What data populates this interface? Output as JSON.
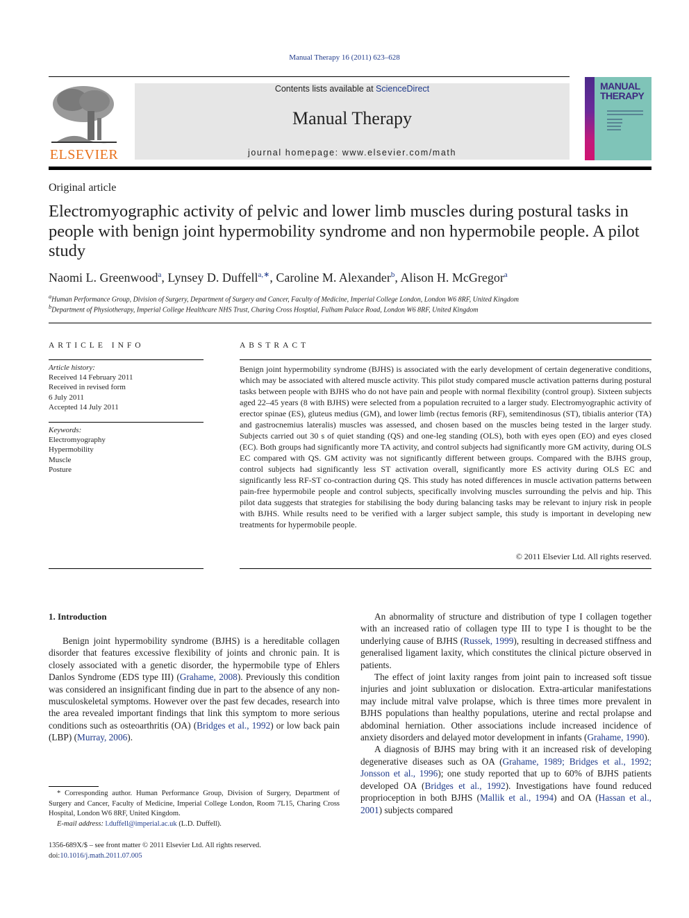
{
  "header": {
    "journal_ref": "Manual Therapy 16 (2011) 623–628",
    "contents_prefix": "Contents lists available at ",
    "contents_link": "ScienceDirect",
    "journal_title": "Manual Therapy",
    "homepage": "journal homepage: www.elsevier.com/math",
    "publisher_logo": "ELSEVIER",
    "cover_title_line1": "MANUAL",
    "cover_title_line2": "THERAPY",
    "colors": {
      "link": "#1f3a8a",
      "elsevier_orange": "#e8711c",
      "masthead_bg": "#e6e6e6",
      "cover_bg": "#7fc4b8"
    }
  },
  "article": {
    "type": "Original article",
    "title": "Electromyographic activity of pelvic and lower limb muscles during postural tasks in people with benign joint hypermobility syndrome and non hypermobile people. A pilot study",
    "authors": [
      {
        "name": "Naomi L. Greenwood",
        "sup": "a"
      },
      {
        "name": "Lynsey D. Duffell",
        "sup": "a,∗"
      },
      {
        "name": "Caroline M. Alexander",
        "sup": "b"
      },
      {
        "name": "Alison H. McGregor",
        "sup": "a"
      }
    ],
    "affiliations": [
      {
        "label": "a",
        "text": "Human Performance Group, Division of Surgery, Department of Surgery and Cancer, Faculty of Medicine, Imperial College London, London W6 8RF, United Kingdom"
      },
      {
        "label": "b",
        "text": "Department of Physiotherapy, Imperial College Healthcare NHS Trust, Charing Cross Hosptial, Fulham Palace Road, London W6 8RF, United Kingdom"
      }
    ]
  },
  "article_info": {
    "heading": "ARTICLE INFO",
    "history_label": "Article history:",
    "history": [
      "Received 14 February 2011",
      "Received in revised form",
      "6 July 2011",
      "Accepted 14 July 2011"
    ],
    "keywords_label": "Keywords:",
    "keywords": [
      "Electromyography",
      "Hypermobility",
      "Muscle",
      "Posture"
    ]
  },
  "abstract": {
    "heading": "ABSTRACT",
    "text": "Benign joint hypermobility syndrome (BJHS) is associated with the early development of certain degenerative conditions, which may be associated with altered muscle activity. This pilot study compared muscle activation patterns during postural tasks between people with BJHS who do not have pain and people with normal flexibility (control group). Sixteen subjects aged 22–45 years (8 with BJHS) were selected from a population recruited to a larger study. Electromyographic activity of erector spinae (ES), gluteus medius (GM), and lower limb (rectus femoris (RF), semitendinosus (ST), tibialis anterior (TA) and gastrocnemius lateralis) muscles was assessed, and chosen based on the muscles being tested in the larger study. Subjects carried out 30 s of quiet standing (QS) and one-leg standing (OLS), both with eyes open (EO) and eyes closed (EC). Both groups had significantly more TA activity, and control subjects had significantly more GM activity, during OLS EC compared with QS. GM activity was not significantly different between groups. Compared with the BJHS group, control subjects had significantly less ST activation overall, significantly more ES activity during OLS EC and significantly less RF-ST co-contraction during QS. This study has noted differences in muscle activation patterns between pain-free hypermobile people and control subjects, specifically involving muscles surrounding the pelvis and hip. This pilot data suggests that strategies for stabilising the body during balancing tasks may be relevant to injury risk in people with BJHS. While results need to be verified with a larger subject sample, this study is important in developing new treatments for hypermobile people.",
    "copyright": "© 2011 Elsevier Ltd. All rights reserved."
  },
  "body": {
    "intro_heading": "1.  Introduction",
    "left": {
      "p1_a": "Benign joint hypermobility syndrome (BJHS) is a hereditable collagen disorder that features excessive flexibility of joints and chronic pain. It is closely associated with a genetic disorder, the hypermobile type of Ehlers Danlos Syndrome (EDS type III) (",
      "cite1": "Grahame, 2008",
      "p1_b": "). Previously this condition was considered an insignificant finding due in part to the absence of any non-musculoskeletal symptoms. However over the past few decades, research into the area revealed important findings that link this symptom to more serious conditions such as osteoarthritis (OA) (",
      "cite2": "Bridges et al., 1992",
      "p1_c": ") or low back pain (LBP) (",
      "cite3": "Murray, 2006",
      "p1_d": ")."
    },
    "right": {
      "p1_a": "An abnormality of structure and distribution of type I collagen together with an increased ratio of collagen type III to type I is thought to be the underlying cause of BJHS (",
      "cite1": "Russek, 1999",
      "p1_b": "), resulting in decreased stiffness and generalised ligament laxity, which constitutes the clinical picture observed in patients.",
      "p2_a": "The effect of joint laxity ranges from joint pain to increased soft tissue injuries and joint subluxation or dislocation. Extra-articular manifestations may include mitral valve prolapse, which is three times more prevalent in BJHS populations than healthy populations, uterine and rectal prolapse and abdominal herniation. Other associations include increased incidence of anxiety disorders and delayed motor development in infants (",
      "cite2": "Grahame, 1990",
      "p2_b": ").",
      "p3_a": "A diagnosis of BJHS may bring with it an increased risk of developing degenerative diseases such as OA (",
      "cite3": "Grahame, 1989; Bridges et al., 1992; Jonsson et al., 1996",
      "p3_b": "); one study reported that up to 60% of BJHS patients developed OA (",
      "cite4": "Bridges et al., 1992",
      "p3_c": "). Investigations have found reduced proprioception in both BJHS (",
      "cite5": "Mallik et al., 1994",
      "p3_d": ") and OA (",
      "cite6": "Hassan et al., 2001",
      "p3_e": ") subjects compared"
    }
  },
  "footnote": {
    "corresponding": "* Corresponding author. Human Performance Group, Division of Surgery, Department of Surgery and Cancer, Faculty of Medicine, Imperial College London, Room 7L15, Charing Cross Hospital, London W6 8RF, United Kingdom.",
    "email_label": "E-mail address: ",
    "email": "l.duffell@imperial.ac.uk",
    "email_suffix": " (L.D. Duffell).",
    "issn": "1356-689X/$ – see front matter © 2011 Elsevier Ltd. All rights reserved.",
    "doi_label": "doi:",
    "doi": "10.1016/j.math.2011.07.005"
  }
}
